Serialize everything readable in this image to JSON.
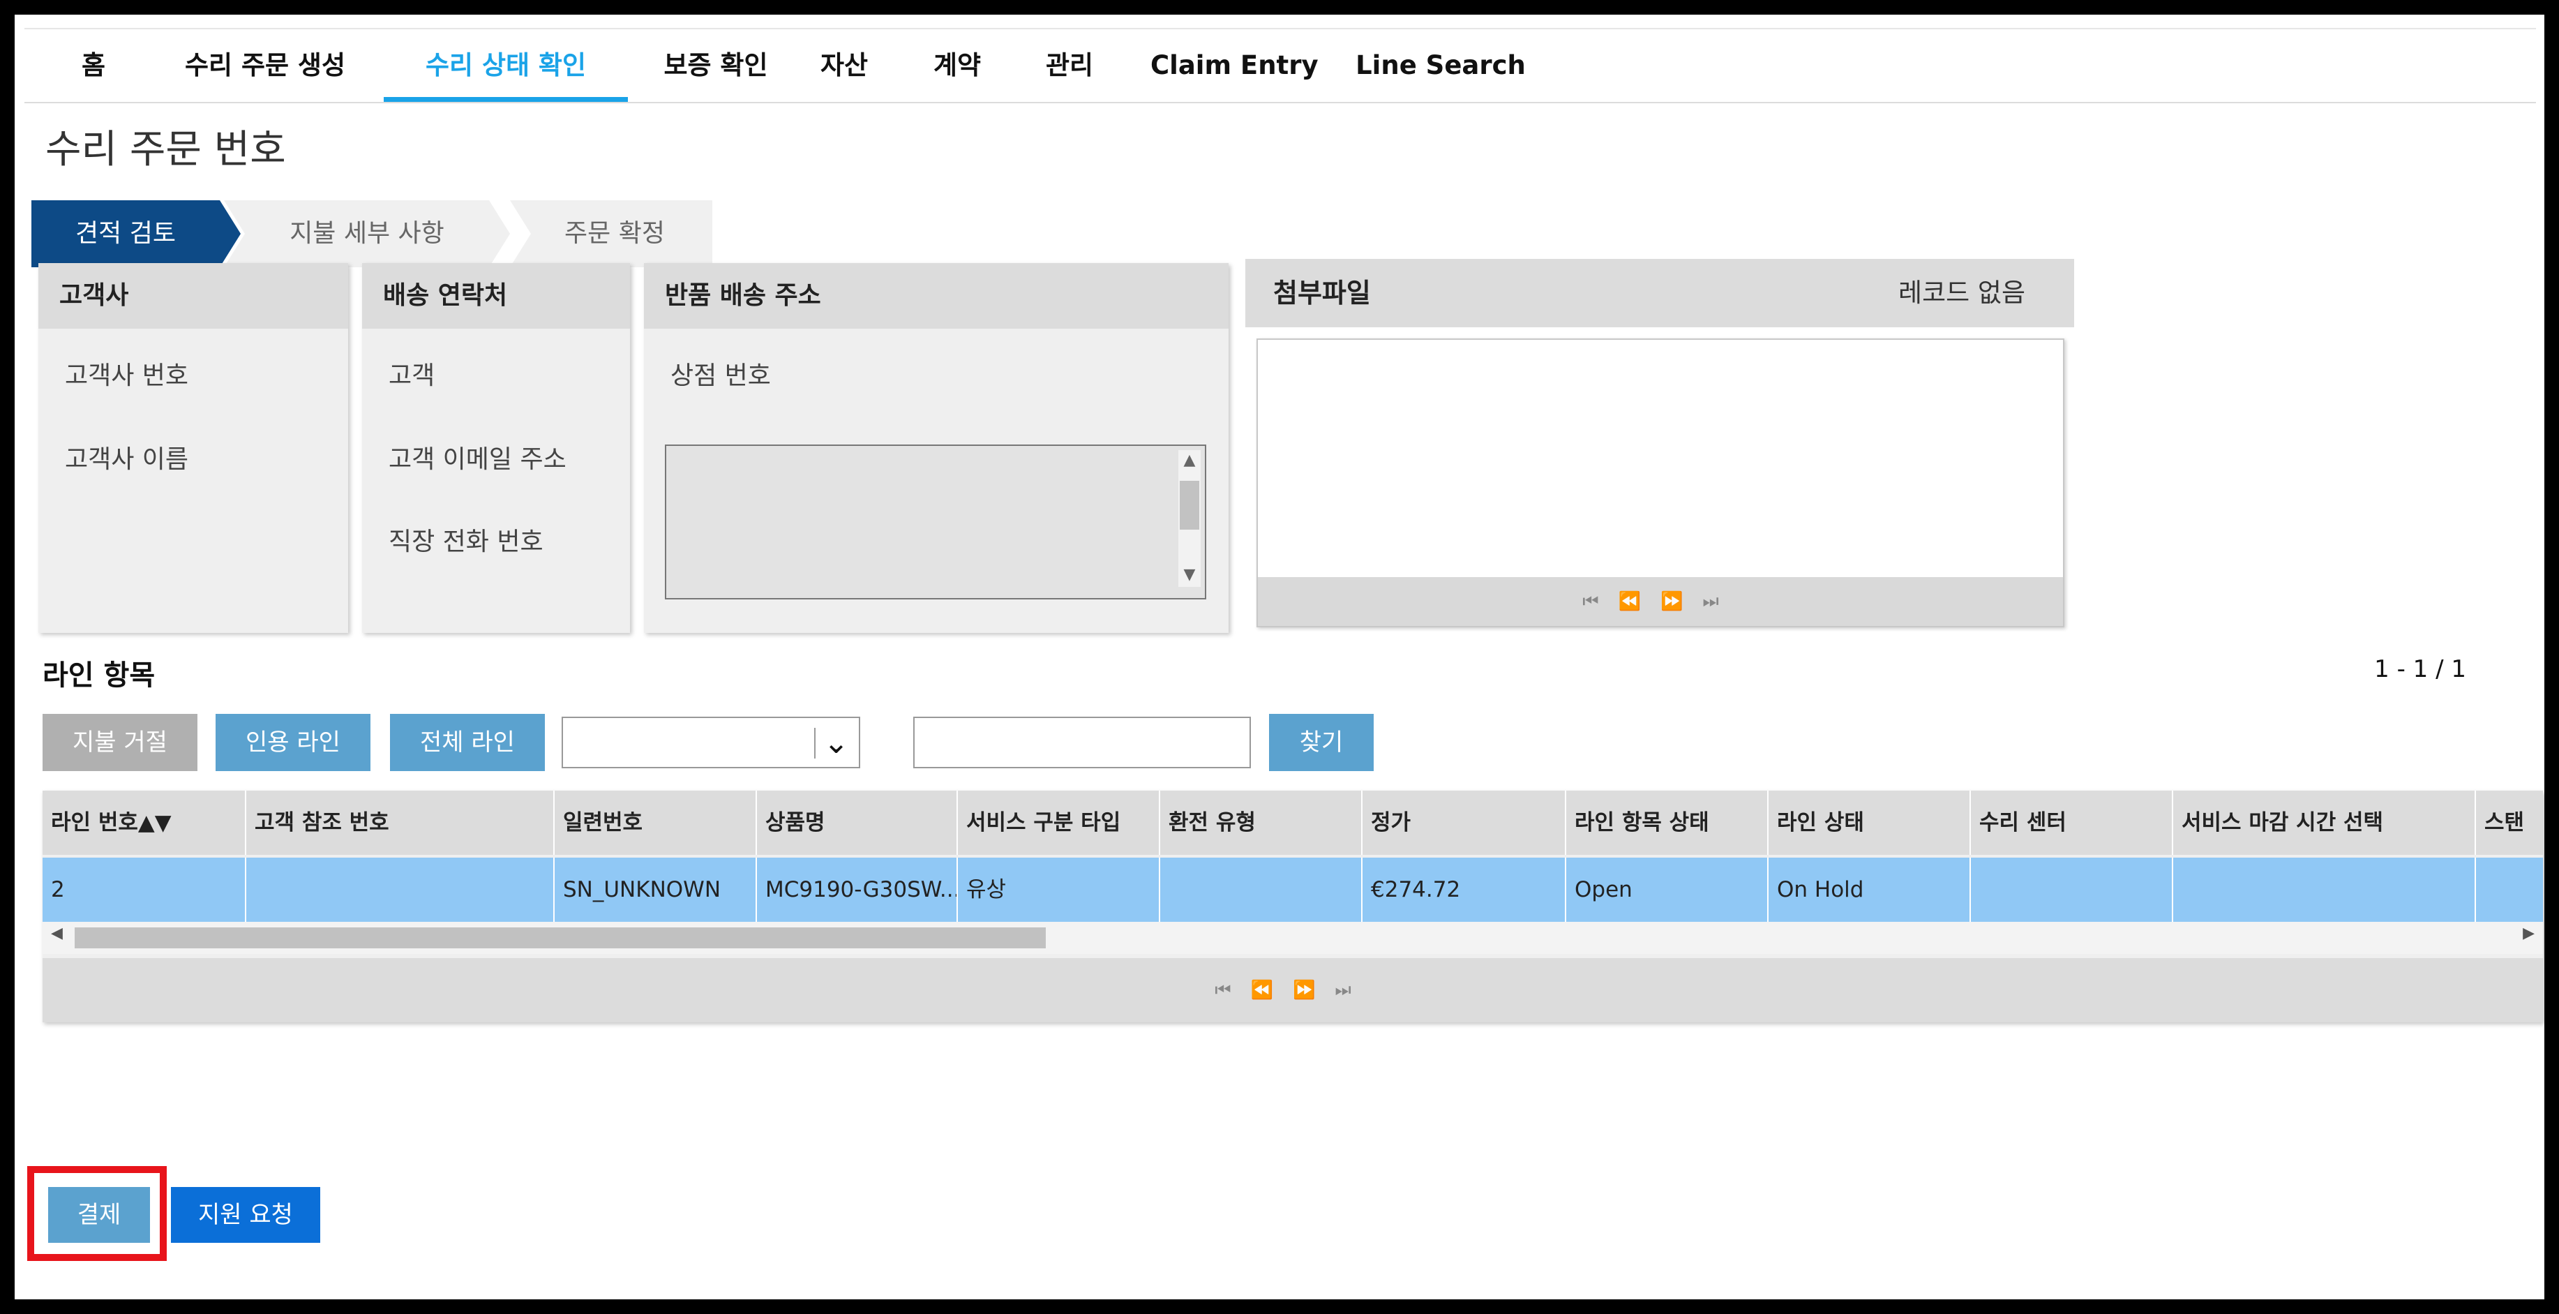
{
  "nav": {
    "items": [
      {
        "label": "홈"
      },
      {
        "label": "수리 주문 생성"
      },
      {
        "label": "수리 상태 확인",
        "active": true
      },
      {
        "label": "보증 확인"
      },
      {
        "label": "자산"
      },
      {
        "label": "계약"
      },
      {
        "label": "관리"
      },
      {
        "label": "Claim Entry"
      },
      {
        "label": "Line Search"
      }
    ],
    "active_color": "#1aa3e8"
  },
  "page": {
    "title": "수리 주문 번호"
  },
  "steps": [
    {
      "label": "견적 검토",
      "active": true
    },
    {
      "label": "지불 세부 사항"
    },
    {
      "label": "주문 확정"
    }
  ],
  "panels": {
    "customer": {
      "title": "고객사",
      "fields": [
        "고객사 번호",
        "고객사 이름"
      ]
    },
    "shipping_contact": {
      "title": "배송 연락처",
      "fields": [
        "고객",
        "고객 이메일 주소",
        "직장 전화 번호"
      ]
    },
    "return_address": {
      "title": "반품 배송 주소",
      "fields": [
        "상점 번호"
      ]
    },
    "attachments": {
      "title": "첨부파일",
      "count_label": "레코드 없음"
    }
  },
  "line_items": {
    "title": "라인 항목",
    "range": "1 - 1 / 1",
    "buttons": {
      "reject_payment": "지불 거절",
      "quoted_lines": "인용 라인",
      "all_lines": "전체 라인",
      "find": "찾기"
    },
    "filter_select_value": "",
    "search_value": "",
    "columns": [
      "라인 번호▲▼",
      "고객 참조 번호",
      "일련번호",
      "상품명",
      "서비스 구분 타입",
      "환전 유형",
      "정가",
      "라인 항목 상태",
      "라인 상태",
      "수리 센터",
      "서비스 마감 시간 선택",
      "스탠"
    ],
    "rows": [
      [
        "2",
        "",
        "SN_UNKNOWN",
        "MC9190-G30SW...",
        "유상",
        "",
        "€274.72",
        "Open",
        "On Hold",
        "",
        "",
        ""
      ]
    ],
    "selected_row_color": "#90c8f5"
  },
  "footer": {
    "pay_label": "결제",
    "support_label": "지원 요청",
    "highlight_color": "#e8141b"
  }
}
